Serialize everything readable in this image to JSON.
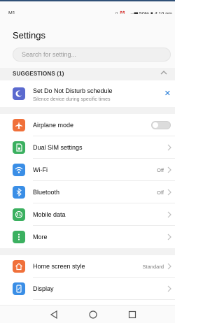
{
  "status": {
    "carrier": "M1",
    "battery": "50%",
    "time": "4:10 pm"
  },
  "page": {
    "title": "Settings",
    "search_placeholder": "Search for setting..."
  },
  "suggestions": {
    "label": "SUGGESTIONS (1)",
    "item": {
      "title": "Set Do Not Disturb schedule",
      "subtitle": "Silence device during specific times",
      "icon": "moon-icon",
      "color": "#5b6acf"
    }
  },
  "rows": [
    {
      "label": "Airplane mode",
      "icon": "airplane-icon",
      "color": "#f0703a",
      "value": "",
      "toggle": "off"
    },
    {
      "label": "Dual SIM settings",
      "icon": "sim-icon",
      "color": "#3bb060",
      "value": ""
    },
    {
      "label": "Wi-Fi",
      "icon": "wifi-icon",
      "color": "#3a8ee6",
      "value": "Off"
    },
    {
      "label": "Bluetooth",
      "icon": "bluetooth-icon",
      "color": "#3a8ee6",
      "value": "Off"
    },
    {
      "label": "Mobile data",
      "icon": "mobile-data-icon",
      "color": "#3bb060",
      "value": ""
    },
    {
      "label": "More",
      "icon": "more-icon",
      "color": "#3bb060",
      "value": ""
    },
    {
      "label": "Home screen style",
      "icon": "home-icon",
      "color": "#f0703a",
      "value": "Standard"
    },
    {
      "label": "Display",
      "icon": "display-icon",
      "color": "#3a8ee6",
      "value": ""
    }
  ],
  "navbar": {
    "back": "back-icon",
    "home": "home-circle-icon",
    "recents": "recents-square-icon"
  }
}
